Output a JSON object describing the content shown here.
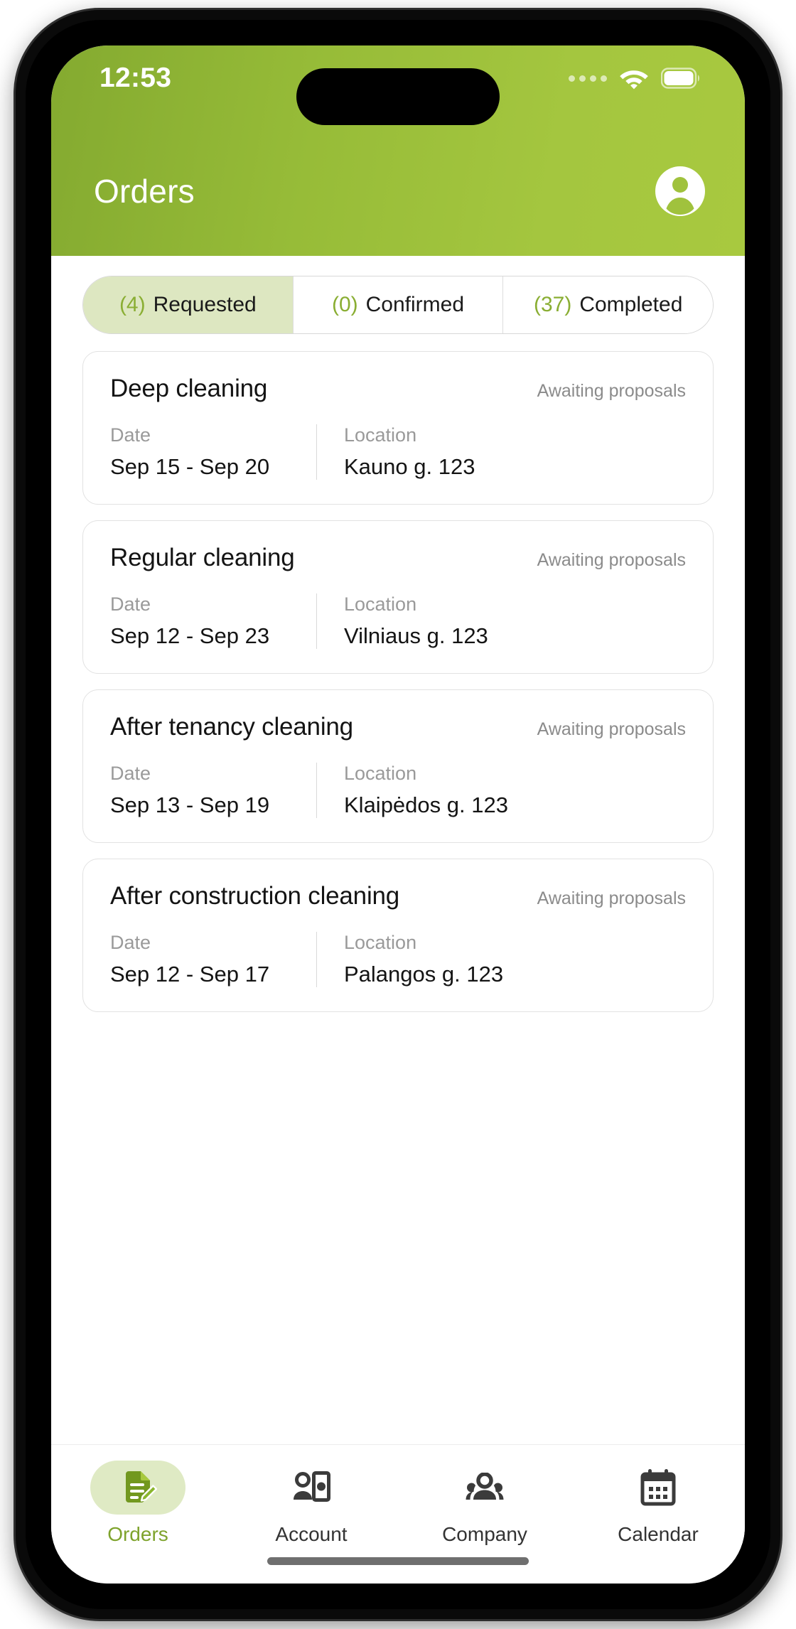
{
  "status_bar": {
    "time": "12:53",
    "signal_icon": "signal-dots-icon",
    "wifi_icon": "wifi-icon",
    "battery_icon": "battery-icon"
  },
  "header": {
    "title": "Orders",
    "avatar_icon": "account-avatar-icon",
    "gradient_start": "#84aa30",
    "gradient_end": "#a8c93f"
  },
  "tabs": [
    {
      "count": "(4)",
      "label": "Requested",
      "active": true
    },
    {
      "count": "(0)",
      "label": "Confirmed",
      "active": false
    },
    {
      "count": "(37)",
      "label": "Completed",
      "active": false
    }
  ],
  "labels": {
    "date": "Date",
    "location": "Location"
  },
  "orders": [
    {
      "title": "Deep cleaning",
      "status": "Awaiting proposals",
      "date_label": "Date",
      "date_value": "Sep 15 - Sep 20",
      "location_label": "Location",
      "location_value": "Kauno g. 123"
    },
    {
      "title": "Regular cleaning",
      "status": "Awaiting proposals",
      "date_label": "Date",
      "date_value": "Sep 12 - Sep 23",
      "location_label": "Location",
      "location_value": "Vilniaus g. 123"
    },
    {
      "title": "After tenancy cleaning",
      "status": "Awaiting proposals",
      "date_label": "Date",
      "date_value": "Sep 13 - Sep 19",
      "location_label": "Location",
      "location_value": "Klaipėdos g. 123"
    },
    {
      "title": "After construction cleaning",
      "status": "Awaiting proposals",
      "date_label": "Date",
      "date_value": "Sep 12 - Sep 17",
      "location_label": "Location",
      "location_value": "Palangos g. 123"
    }
  ],
  "bottom_nav": [
    {
      "label": "Orders",
      "icon": "document-edit-icon",
      "active": true
    },
    {
      "label": "Account",
      "icon": "person-money-icon",
      "active": false
    },
    {
      "label": "Company",
      "icon": "people-group-icon",
      "active": false
    },
    {
      "label": "Calendar",
      "icon": "calendar-icon",
      "active": false
    }
  ],
  "colors": {
    "accent_green": "#8aae33",
    "active_tab_bg": "#dde7c1",
    "nav_active_bg": "#dfeac4",
    "nav_active_text": "#7ea32c",
    "muted_text": "#9a9a9a"
  }
}
